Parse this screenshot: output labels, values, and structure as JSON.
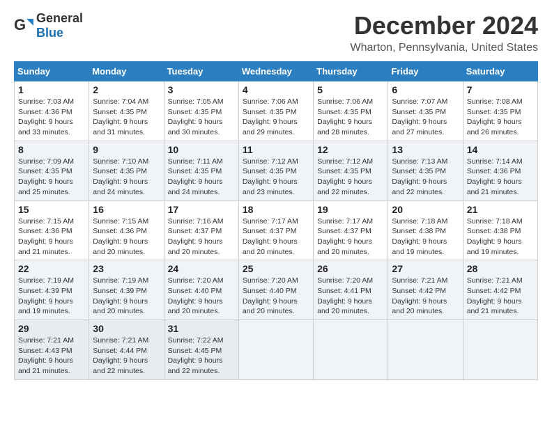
{
  "logo": {
    "general": "General",
    "blue": "Blue"
  },
  "title": {
    "month_year": "December 2024",
    "location": "Wharton, Pennsylvania, United States"
  },
  "weekdays": [
    "Sunday",
    "Monday",
    "Tuesday",
    "Wednesday",
    "Thursday",
    "Friday",
    "Saturday"
  ],
  "weeks": [
    [
      {
        "day": "1",
        "sunrise": "7:03 AM",
        "sunset": "4:36 PM",
        "daylight": "9 hours and 33 minutes."
      },
      {
        "day": "2",
        "sunrise": "7:04 AM",
        "sunset": "4:35 PM",
        "daylight": "9 hours and 31 minutes."
      },
      {
        "day": "3",
        "sunrise": "7:05 AM",
        "sunset": "4:35 PM",
        "daylight": "9 hours and 30 minutes."
      },
      {
        "day": "4",
        "sunrise": "7:06 AM",
        "sunset": "4:35 PM",
        "daylight": "9 hours and 29 minutes."
      },
      {
        "day": "5",
        "sunrise": "7:06 AM",
        "sunset": "4:35 PM",
        "daylight": "9 hours and 28 minutes."
      },
      {
        "day": "6",
        "sunrise": "7:07 AM",
        "sunset": "4:35 PM",
        "daylight": "9 hours and 27 minutes."
      },
      {
        "day": "7",
        "sunrise": "7:08 AM",
        "sunset": "4:35 PM",
        "daylight": "9 hours and 26 minutes."
      }
    ],
    [
      {
        "day": "8",
        "sunrise": "7:09 AM",
        "sunset": "4:35 PM",
        "daylight": "9 hours and 25 minutes."
      },
      {
        "day": "9",
        "sunrise": "7:10 AM",
        "sunset": "4:35 PM",
        "daylight": "9 hours and 24 minutes."
      },
      {
        "day": "10",
        "sunrise": "7:11 AM",
        "sunset": "4:35 PM",
        "daylight": "9 hours and 24 minutes."
      },
      {
        "day": "11",
        "sunrise": "7:12 AM",
        "sunset": "4:35 PM",
        "daylight": "9 hours and 23 minutes."
      },
      {
        "day": "12",
        "sunrise": "7:12 AM",
        "sunset": "4:35 PM",
        "daylight": "9 hours and 22 minutes."
      },
      {
        "day": "13",
        "sunrise": "7:13 AM",
        "sunset": "4:35 PM",
        "daylight": "9 hours and 22 minutes."
      },
      {
        "day": "14",
        "sunrise": "7:14 AM",
        "sunset": "4:36 PM",
        "daylight": "9 hours and 21 minutes."
      }
    ],
    [
      {
        "day": "15",
        "sunrise": "7:15 AM",
        "sunset": "4:36 PM",
        "daylight": "9 hours and 21 minutes."
      },
      {
        "day": "16",
        "sunrise": "7:15 AM",
        "sunset": "4:36 PM",
        "daylight": "9 hours and 20 minutes."
      },
      {
        "day": "17",
        "sunrise": "7:16 AM",
        "sunset": "4:37 PM",
        "daylight": "9 hours and 20 minutes."
      },
      {
        "day": "18",
        "sunrise": "7:17 AM",
        "sunset": "4:37 PM",
        "daylight": "9 hours and 20 minutes."
      },
      {
        "day": "19",
        "sunrise": "7:17 AM",
        "sunset": "4:37 PM",
        "daylight": "9 hours and 20 minutes."
      },
      {
        "day": "20",
        "sunrise": "7:18 AM",
        "sunset": "4:38 PM",
        "daylight": "9 hours and 19 minutes."
      },
      {
        "day": "21",
        "sunrise": "7:18 AM",
        "sunset": "4:38 PM",
        "daylight": "9 hours and 19 minutes."
      }
    ],
    [
      {
        "day": "22",
        "sunrise": "7:19 AM",
        "sunset": "4:39 PM",
        "daylight": "9 hours and 19 minutes."
      },
      {
        "day": "23",
        "sunrise": "7:19 AM",
        "sunset": "4:39 PM",
        "daylight": "9 hours and 20 minutes."
      },
      {
        "day": "24",
        "sunrise": "7:20 AM",
        "sunset": "4:40 PM",
        "daylight": "9 hours and 20 minutes."
      },
      {
        "day": "25",
        "sunrise": "7:20 AM",
        "sunset": "4:40 PM",
        "daylight": "9 hours and 20 minutes."
      },
      {
        "day": "26",
        "sunrise": "7:20 AM",
        "sunset": "4:41 PM",
        "daylight": "9 hours and 20 minutes."
      },
      {
        "day": "27",
        "sunrise": "7:21 AM",
        "sunset": "4:42 PM",
        "daylight": "9 hours and 20 minutes."
      },
      {
        "day": "28",
        "sunrise": "7:21 AM",
        "sunset": "4:42 PM",
        "daylight": "9 hours and 21 minutes."
      }
    ],
    [
      {
        "day": "29",
        "sunrise": "7:21 AM",
        "sunset": "4:43 PM",
        "daylight": "9 hours and 21 minutes."
      },
      {
        "day": "30",
        "sunrise": "7:21 AM",
        "sunset": "4:44 PM",
        "daylight": "9 hours and 22 minutes."
      },
      {
        "day": "31",
        "sunrise": "7:22 AM",
        "sunset": "4:45 PM",
        "daylight": "9 hours and 22 minutes."
      },
      null,
      null,
      null,
      null
    ]
  ]
}
